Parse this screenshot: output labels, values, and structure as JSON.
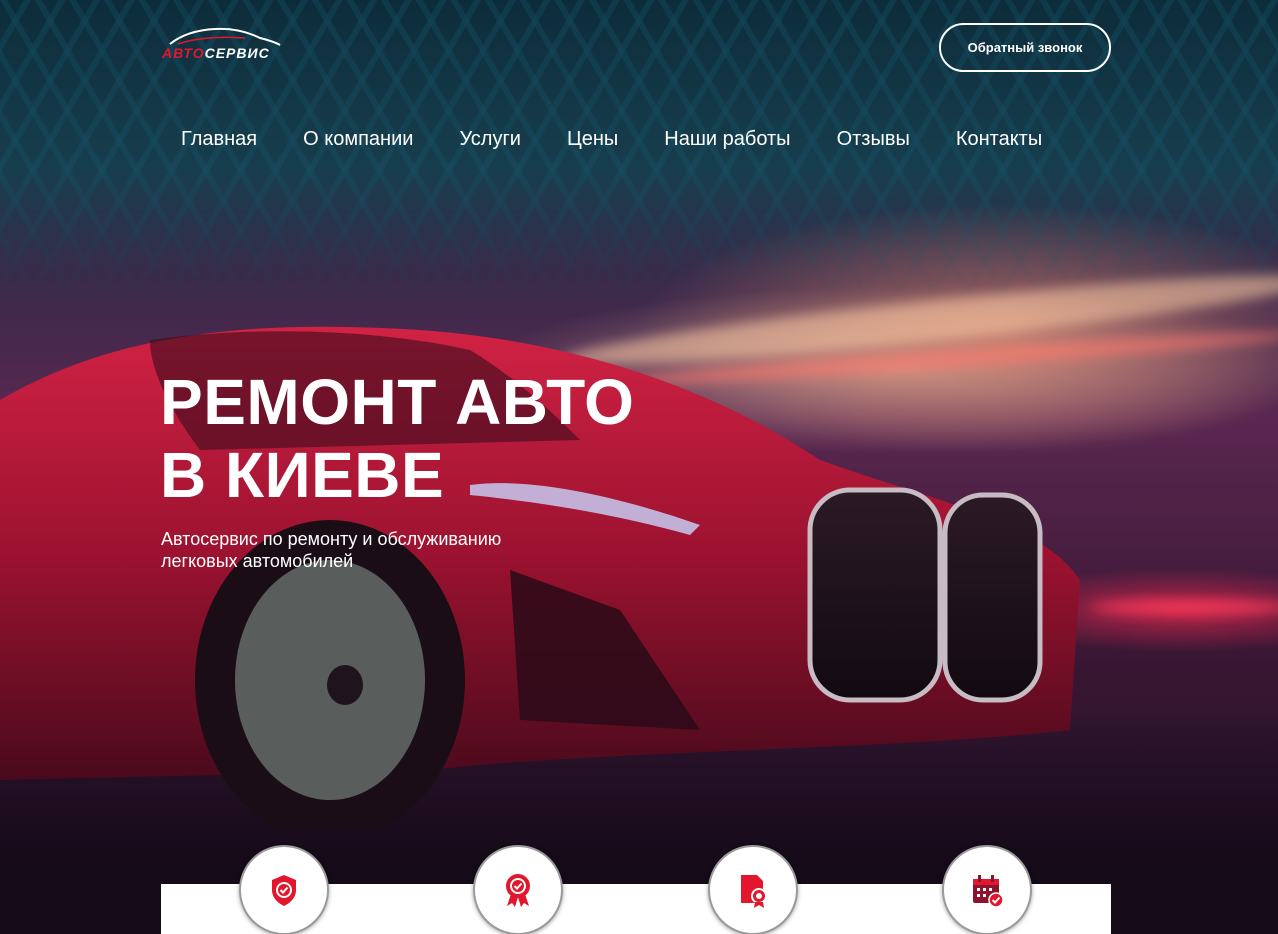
{
  "header": {
    "logo": {
      "part1": "АВТО",
      "part2": "СЕРВИС"
    },
    "callback_label": "Обратный звонок"
  },
  "nav": {
    "items": [
      "Главная",
      "О компании",
      "Услуги",
      "Цены",
      "Наши работы",
      "Отзывы",
      "Контакты"
    ]
  },
  "hero": {
    "title_line1": "РЕМОНТ АВТО",
    "title_line2": "В КИЕВЕ",
    "subtitle": "Автосервис по ремонту и обслуживанию легковых автомобилей"
  },
  "features": {
    "icons": [
      "shield-check-icon",
      "award-ribbon-icon",
      "document-certificate-icon",
      "calendar-check-icon"
    ]
  },
  "colors": {
    "accent": "#e2172d",
    "text": "#ffffff"
  }
}
